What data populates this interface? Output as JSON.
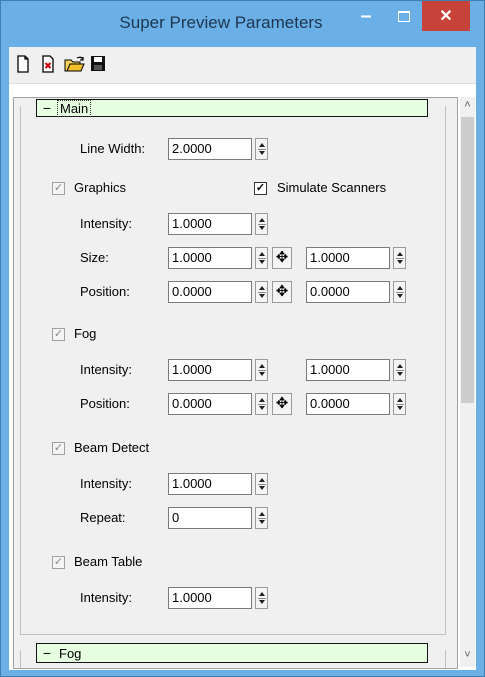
{
  "window": {
    "title": "Super Preview Parameters",
    "minimize_glyph": "–",
    "close_glyph": "✕"
  },
  "toolbar": {
    "icons": [
      "new-document-icon",
      "clear-document-icon",
      "open-folder-icon",
      "save-icon"
    ]
  },
  "main_group": {
    "header": "Main",
    "collapse_glyph": "−",
    "line_width_label": "Line Width:",
    "line_width_value": "2.0000",
    "graphics": {
      "label": "Graphics",
      "checked": true,
      "simulate_scanners_label": "Simulate Scanners",
      "simulate_scanners_checked": true,
      "intensity_label": "Intensity:",
      "intensity_value": "1.0000",
      "size_label": "Size:",
      "size_x": "1.0000",
      "size_y": "1.0000",
      "position_label": "Position:",
      "position_x": "0.0000",
      "position_y": "0.0000"
    },
    "fog": {
      "label": "Fog",
      "checked": true,
      "intensity_label": "Intensity:",
      "intensity_a": "1.0000",
      "intensity_b": "1.0000",
      "position_label": "Position:",
      "position_x": "0.0000",
      "position_y": "0.0000"
    },
    "beam_detect": {
      "label": "Beam Detect",
      "checked": true,
      "intensity_label": "Intensity:",
      "intensity_value": "1.0000",
      "repeat_label": "Repeat:",
      "repeat_value": "0"
    },
    "beam_table": {
      "label": "Beam Table",
      "checked": true,
      "intensity_label": "Intensity:",
      "intensity_value": "1.0000"
    }
  },
  "fog_group": {
    "header": "Fog",
    "collapse_glyph": "−"
  },
  "glyphs": {
    "check": "✓",
    "link": "✥",
    "scroll_up": "˄",
    "scroll_down": "˅"
  },
  "colors": {
    "titlebar": "#6ab0e6",
    "close_button": "#c7433a",
    "group_header_fill": "#e6ffe0"
  }
}
